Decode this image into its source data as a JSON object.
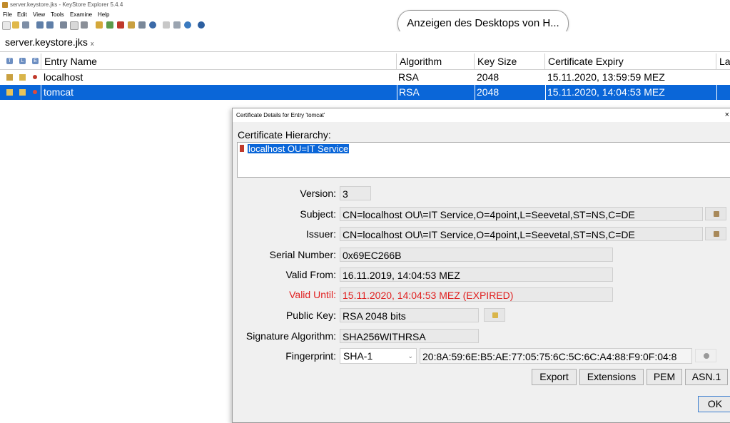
{
  "window": {
    "title": "server.keystore.jks - KeyStore Explorer 5.4.4"
  },
  "menu": [
    "File",
    "Edit",
    "View",
    "Tools",
    "Examine",
    "Help"
  ],
  "tooltip_pill": "Anzeigen des Desktops von H...",
  "tab": {
    "label": "server.keystore.jks",
    "close": "x"
  },
  "table": {
    "icon_headers": [
      "T",
      "L",
      "E"
    ],
    "columns": [
      "Entry Name",
      "Algorithm",
      "Key Size",
      "Certificate Expiry",
      "La"
    ],
    "rows": [
      {
        "name": "localhost",
        "algorithm": "RSA",
        "key_size": "2048",
        "expiry": "15.11.2020, 13:59:59 MEZ",
        "selected": false
      },
      {
        "name": "tomcat",
        "algorithm": "RSA",
        "key_size": "2048",
        "expiry": "15.11.2020, 14:04:53 MEZ",
        "selected": true
      }
    ]
  },
  "dialog": {
    "title": "Certificate Details for Entry 'tomcat'",
    "close": "×",
    "hierarchy_label": "Certificate Hierarchy:",
    "hierarchy_item": "localhost OU=IT Service",
    "fields": {
      "version_label": "Version:",
      "version": "3",
      "subject_label": "Subject:",
      "subject": "CN=localhost OU\\=IT Service,O=4point,L=Seevetal,ST=NS,C=DE",
      "issuer_label": "Issuer:",
      "issuer": "CN=localhost OU\\=IT Service,O=4point,L=Seevetal,ST=NS,C=DE",
      "serial_label": "Serial Number:",
      "serial": "0x69EC266B",
      "valid_from_label": "Valid From:",
      "valid_from": "16.11.2019, 14:04:53 MEZ",
      "valid_until_label": "Valid Until:",
      "valid_until": "15.11.2020, 14:04:53 MEZ (EXPIRED)",
      "public_key_label": "Public Key:",
      "public_key": "RSA 2048 bits",
      "sig_alg_label": "Signature Algorithm:",
      "sig_alg": "SHA256WITHRSA",
      "fingerprint_label": "Fingerprint:",
      "fingerprint_alg": "SHA-1",
      "fingerprint": "20:8A:59:6E:B5:AE:77:05:75:6C:5C:6C:A4:88:F9:0F:04:8"
    },
    "buttons": {
      "export": "Export",
      "extensions": "Extensions",
      "pem": "PEM",
      "asn1": "ASN.1",
      "ok": "OK"
    }
  },
  "colors": {
    "selection": "#0a66d8",
    "expired": "#e02020",
    "dialog_bg": "#f0f0f0"
  }
}
